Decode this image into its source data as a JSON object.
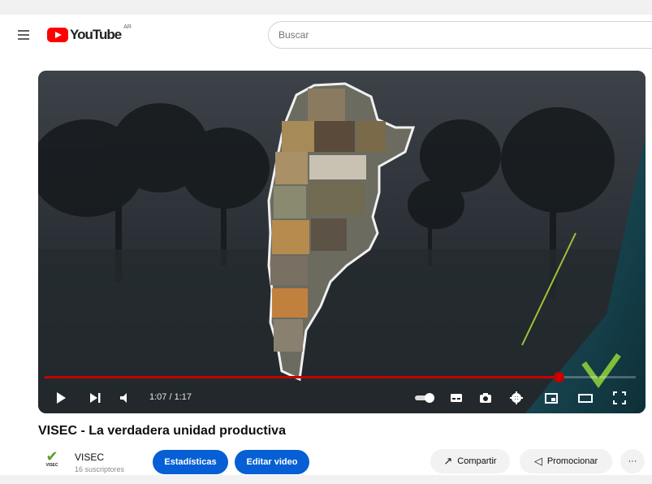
{
  "header": {
    "logo_text": "YouTube",
    "logo_country": "AR",
    "search_placeholder": "Buscar"
  },
  "player": {
    "time": "1:07 / 1:17",
    "progress_fraction": 0.87,
    "progress_color": "#c80000"
  },
  "video": {
    "title": "VISEC - La verdadera unidad productiva"
  },
  "channel": {
    "name": "VISEC",
    "subscribers": "16 suscriptores",
    "logo_text": "VISEC",
    "brand_color": "#5aa02c"
  },
  "actions": {
    "stats_label": "Estadísticas",
    "edit_label": "Editar video",
    "share_label": "Compartir",
    "promote_label": "Promocionar",
    "more_label": "···"
  },
  "colors": {
    "accent_blue": "#065fd4"
  }
}
